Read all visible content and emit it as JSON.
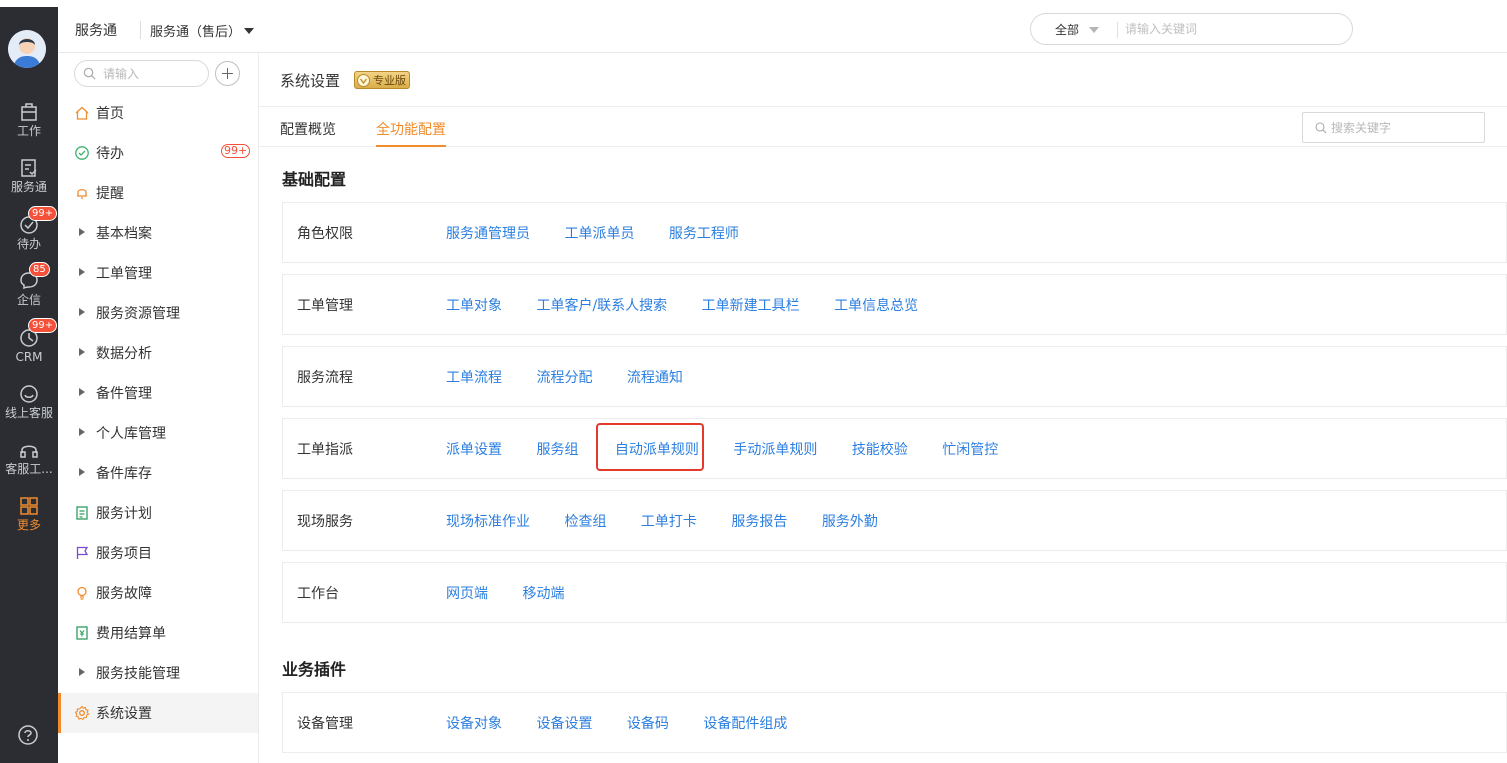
{
  "rail": {
    "items": [
      {
        "label": "工作",
        "icon": "work-icon"
      },
      {
        "label": "服务通",
        "icon": "service-icon"
      },
      {
        "label": "待办",
        "icon": "todo-icon",
        "badge": "99+"
      },
      {
        "label": "企信",
        "icon": "chat-icon",
        "badge": "85"
      },
      {
        "label": "CRM",
        "icon": "crm-icon",
        "badge": "99+"
      },
      {
        "label": "线上客服",
        "icon": "online-service-icon"
      },
      {
        "label": "客服工...",
        "icon": "headset-icon"
      },
      {
        "label": "更多",
        "icon": "grid-icon"
      }
    ],
    "help_icon": "help-icon",
    "accent_color": "#f08c2d"
  },
  "header": {
    "app_name": "服务通",
    "module": "服务通（售后）",
    "search_scope": "全部",
    "search_placeholder": "请输入关键词"
  },
  "menu": {
    "search_placeholder": "请输入",
    "items": [
      {
        "label": "首页",
        "icon": "home-icon"
      },
      {
        "label": "待办",
        "icon": "check-circle-icon",
        "badge": "99+"
      },
      {
        "label": "提醒",
        "icon": "bell-icon"
      },
      {
        "label": "基本档案",
        "icon": "expand-triangle-icon"
      },
      {
        "label": "工单管理",
        "icon": "expand-triangle-icon"
      },
      {
        "label": "服务资源管理",
        "icon": "expand-triangle-icon"
      },
      {
        "label": "数据分析",
        "icon": "expand-triangle-icon"
      },
      {
        "label": "备件管理",
        "icon": "expand-triangle-icon"
      },
      {
        "label": "个人库管理",
        "icon": "expand-triangle-icon"
      },
      {
        "label": "备件库存",
        "icon": "expand-triangle-icon"
      },
      {
        "label": "服务计划",
        "icon": "plan-icon"
      },
      {
        "label": "服务项目",
        "icon": "flag-icon"
      },
      {
        "label": "服务故障",
        "icon": "bulb-icon"
      },
      {
        "label": "费用结算单",
        "icon": "bill-icon"
      },
      {
        "label": "服务技能管理",
        "icon": "expand-triangle-icon"
      },
      {
        "label": "系统设置",
        "icon": "gear-icon",
        "active": true
      }
    ]
  },
  "main": {
    "title": "系统设置",
    "edition_badge": "专业版",
    "tabs": [
      "配置概览",
      "全功能配置"
    ],
    "active_tab": "全功能配置",
    "keyword_placeholder": "搜索关键字",
    "sections": [
      {
        "title": "基础配置",
        "groups": [
          {
            "name": "角色权限",
            "links": [
              "服务通管理员",
              "工单派单员",
              "服务工程师"
            ]
          },
          {
            "name": "工单管理",
            "links": [
              "工单对象",
              "工单客户/联系人搜索",
              "工单新建工具栏",
              "工单信息总览"
            ]
          },
          {
            "name": "服务流程",
            "links": [
              "工单流程",
              "流程分配",
              "流程通知"
            ]
          },
          {
            "name": "工单指派",
            "links": [
              "派单设置",
              "服务组",
              "自动派单规则",
              "手动派单规则",
              "技能校验",
              "忙闲管控"
            ],
            "highlighted": "自动派单规则"
          },
          {
            "name": "现场服务",
            "links": [
              "现场标准作业",
              "检查组",
              "工单打卡",
              "服务报告",
              "服务外勤"
            ]
          },
          {
            "name": "工作台",
            "links": [
              "网页端",
              "移动端"
            ]
          }
        ]
      },
      {
        "title": "业务插件",
        "groups": [
          {
            "name": "设备管理",
            "links": [
              "设备对象",
              "设备设置",
              "设备码",
              "设备配件组成"
            ]
          }
        ]
      }
    ],
    "link_color": "#2c7fe0",
    "highlight_color": "#e33a2c"
  }
}
